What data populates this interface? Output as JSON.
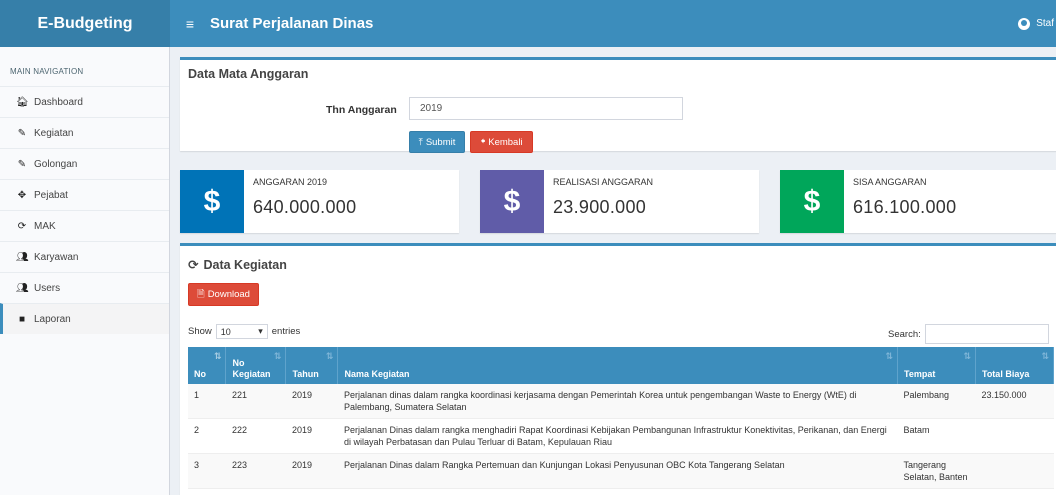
{
  "header": {
    "brand": "E-Budgeting",
    "menu_icon": "hamburger-icon",
    "page_title": "Surat Perjalanan Dinas",
    "user_label": "Staf"
  },
  "sidebar": {
    "heading": "MAIN NAVIGATION",
    "items": [
      {
        "label": "Dashboard",
        "icon": "home-icon",
        "glyph": "🏠︎"
      },
      {
        "label": "Kegiatan",
        "icon": "edit-icon",
        "glyph": "✎"
      },
      {
        "label": "Golongan",
        "icon": "edit-icon",
        "glyph": "✎"
      },
      {
        "label": "Pejabat",
        "icon": "drag-icon",
        "glyph": "✥"
      },
      {
        "label": "MAK",
        "icon": "refresh-icon",
        "glyph": "⟳"
      },
      {
        "label": "Karyawan",
        "icon": "users-icon",
        "glyph": "👥︎"
      },
      {
        "label": "Users",
        "icon": "users-icon",
        "glyph": "👥︎"
      },
      {
        "label": "Laporan",
        "icon": "folder-icon",
        "glyph": "■"
      }
    ]
  },
  "form": {
    "title": "Data Mata Anggaran",
    "year_label": "Thn Anggaran",
    "year_value": "2019",
    "submit_label": "Submit",
    "back_label": "Kembali"
  },
  "info_boxes": [
    {
      "label": "ANGGARAN 2019",
      "value": "640.000.000",
      "icon": "dollar-icon",
      "color": "#0073b7"
    },
    {
      "label": "REALISASI ANGGARAN",
      "value": "23.900.000",
      "icon": "dollar-icon",
      "color": "#605ca8"
    },
    {
      "label": "SISA ANGGARAN",
      "value": "616.100.000",
      "icon": "dollar-icon",
      "color": "#00a65a"
    }
  ],
  "activities": {
    "title": "Data Kegiatan",
    "download_label": "Download",
    "show_label": "Show",
    "show_value": "10",
    "entries_label": "entries",
    "search_label": "Search:",
    "columns": [
      "No",
      "No Kegiatan",
      "Tahun",
      "Nama Kegiatan",
      "Tempat",
      "Total Biaya"
    ],
    "rows": [
      {
        "no": "1",
        "no_kegiatan": "221",
        "tahun": "2019",
        "nama": "Perjalanan dinas dalam rangka koordinasi kerjasama dengan Pemerintah Korea untuk pengembangan Waste to Energy (WtE) di Palembang, Sumatera Selatan",
        "tempat": "Palembang",
        "total": "23.150.000"
      },
      {
        "no": "2",
        "no_kegiatan": "222",
        "tahun": "2019",
        "nama": "Perjalanan Dinas dalam rangka menghadiri Rapat Koordinasi Kebijakan Pembangunan Infrastruktur Konektivitas, Perikanan, dan Energi di wilayah Perbatasan dan Pulau Terluar di Batam, Kepulauan Riau",
        "tempat": "Batam",
        "total": ""
      },
      {
        "no": "3",
        "no_kegiatan": "223",
        "tahun": "2019",
        "nama": "Perjalanan Dinas dalam Rangka Pertemuan dan Kunjungan Lokasi Penyusunan OBC Kota Tangerang Selatan",
        "tempat": "Tangerang Selatan, Banten",
        "total": ""
      }
    ]
  },
  "colors": {
    "brand": "#367fa9",
    "navbar": "#3c8dbc",
    "danger": "#dd4b39"
  }
}
